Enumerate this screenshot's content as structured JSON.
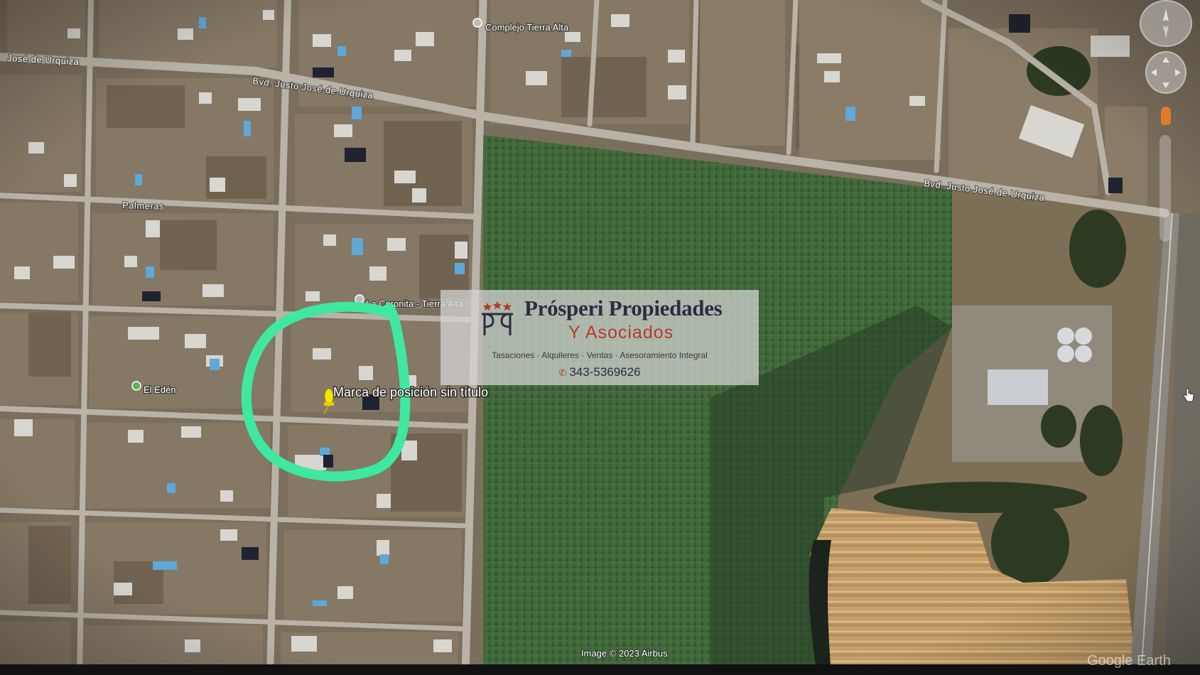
{
  "streets": {
    "justo_jose_de_urquiza_1": "Bvd. Justo José de Urquiza",
    "justo_jose_de_urquiza_2": "Bvd. Justo José de Urquiza",
    "jose_de_urquiza_left": "José de Urquiza",
    "palmeras": "Palmeras"
  },
  "places": {
    "complejo_tierra_alta": "Complejo Tierra Alta",
    "la_coronita": "La Coronita - Tierra Alta",
    "el_eden": "El Edén"
  },
  "marker": {
    "label": "Marca de posición sin título",
    "icon": "pushpin-icon",
    "color": "#f2e600"
  },
  "highlight_circle": {
    "color": "#3ee8a0"
  },
  "watermark": {
    "title": "Prósperi Propiedades",
    "subtitle": "Y Asociados",
    "services": "Tasaciones · Alquileres · Ventas · Asesoramiento Integral",
    "phone": "343-5369626",
    "phone_icon": "phone-icon",
    "title_color": "#2b2d42",
    "accent_color": "#b53a2c"
  },
  "credits": {
    "imagery": "Image © 2023 Airbus",
    "brand": "Google Earth"
  },
  "controls": {
    "compass": "compass-icon",
    "pan": "pan-icon",
    "street_view": "person-icon",
    "zoom": "zoom-slider",
    "cursor": "hand-cursor-icon"
  }
}
